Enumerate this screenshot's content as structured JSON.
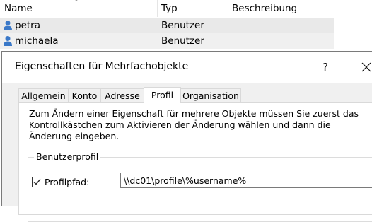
{
  "listview": {
    "columns": [
      "Name",
      "Typ",
      "Beschreibung"
    ],
    "rows": [
      {
        "name": "petra",
        "type": "Benutzer"
      },
      {
        "name": "michaela",
        "type": "Benutzer"
      }
    ]
  },
  "dialog": {
    "title": "Eigenschaften für Mehrfachobjekte",
    "help": "?",
    "tabs": [
      "Allgemein",
      "Konto",
      "Adresse",
      "Profil",
      "Organisation"
    ],
    "active_tab": "Profil",
    "description": "Zum Ändern einer Eigenschaft für mehrere Objekte müssen Sie zuerst das Kontrollkästchen zum Aktivieren der Änderung wählen und dann die Änderung eingeben.",
    "group_title": "Benutzerprofil",
    "profile_path_label": "Profilpfad:",
    "profile_path_checked": true,
    "profile_path_value": "\\\\dc01\\profile\\%username%"
  },
  "colors": {
    "row_selected": "#e9e9e9",
    "dialog_bg": "#f0f0f0",
    "icon_blue": "#3a78c8"
  },
  "icons": [
    "user-icon",
    "close-icon",
    "checkmark-icon"
  ]
}
